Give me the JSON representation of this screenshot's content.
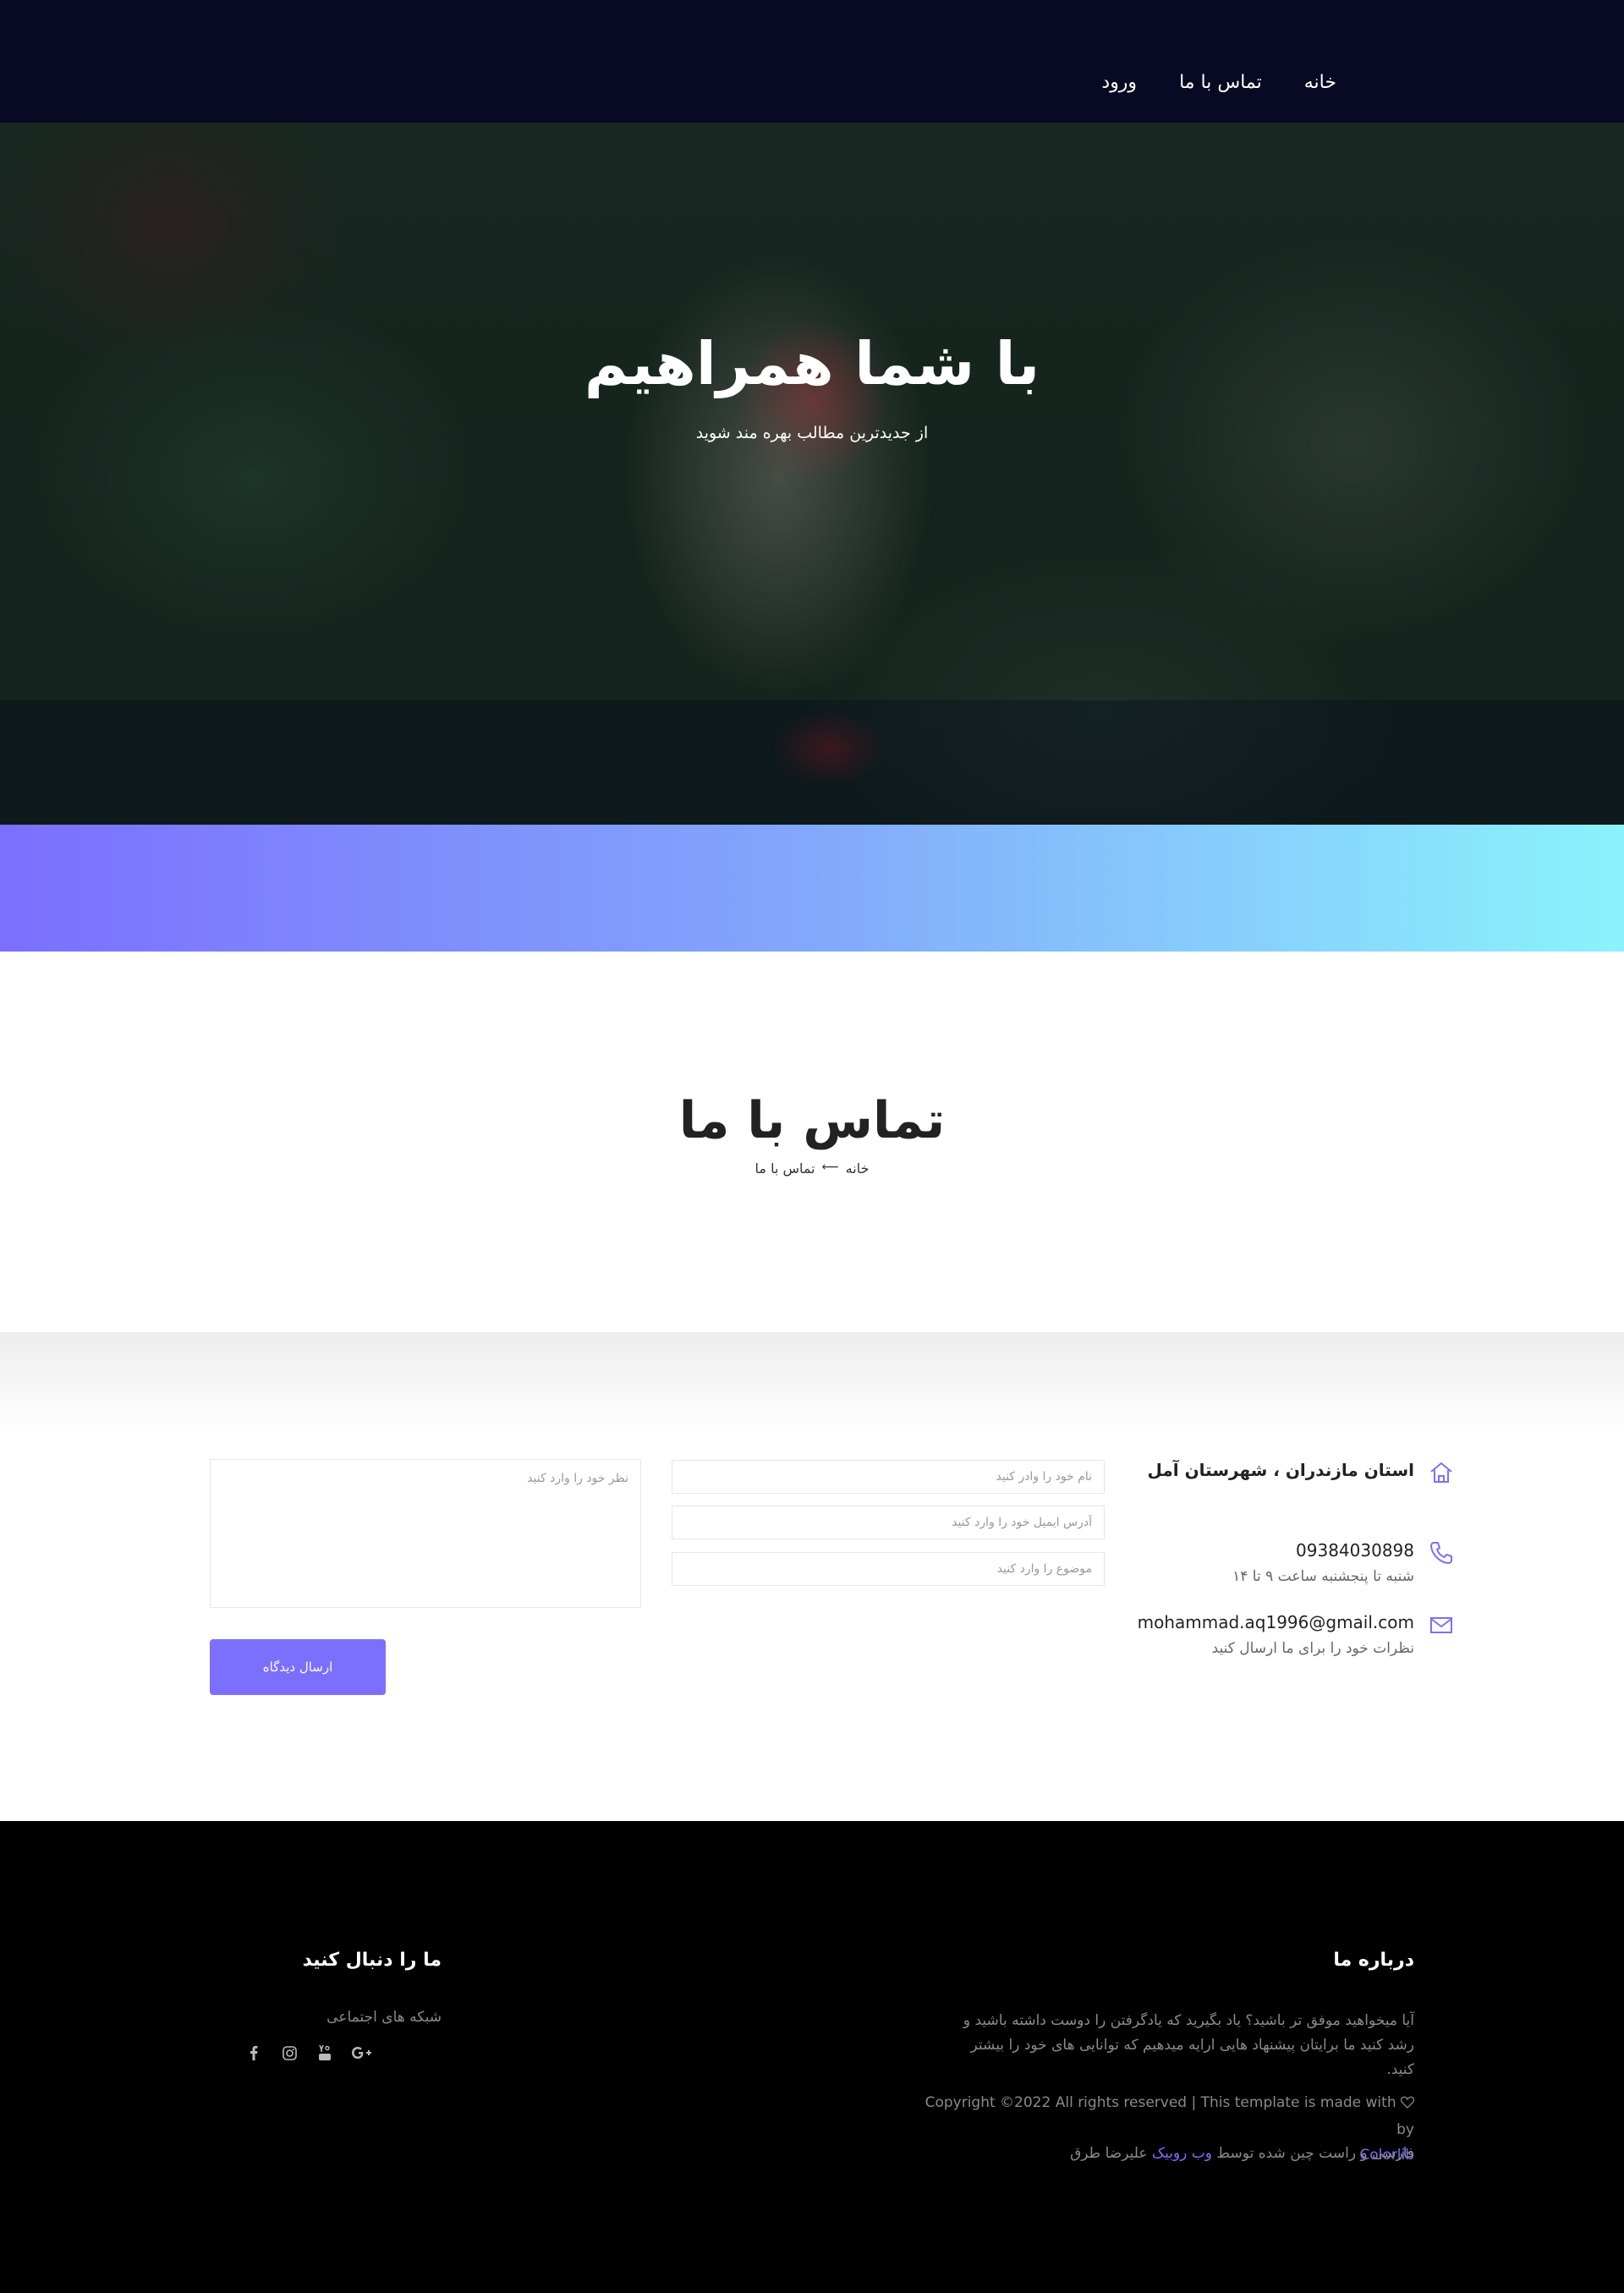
{
  "nav": {
    "items": [
      "خانه",
      "تماس با ما",
      "ورود"
    ]
  },
  "hero": {
    "title": "با شما همراهیم",
    "subtitle": "از جدیدترین مطالب بهره مند شوید"
  },
  "page": {
    "title": "تماس با ما",
    "breadcrumb": {
      "home": "خانه",
      "current": "تماس با ما"
    }
  },
  "contact": {
    "address": "استان مازندران ، شهرستان آمل",
    "phone": "09384030898",
    "phone_hours": "شنبه تا پنجشنبه ساعت ۹ تا ۱۴",
    "email": "mohammad.aq1996@gmail.com",
    "email_note": "نظرات خود را برای ما ارسال کنید"
  },
  "form": {
    "name_placeholder": "نام خود را وادر کنید",
    "email_placeholder": "آدرس ایمیل خود را وارد کنید",
    "subject_placeholder": "موضوع را وارد کنید",
    "message_placeholder": "نظر خود را وارد کنید",
    "submit_label": "ارسال دیدگاه"
  },
  "footer": {
    "about_title": "درباره ما",
    "about_text": "آیا میخواهید موفق تر باشید؟ یاد بگیرید که یادگرفتن را دوست داشته باشید و رشد کنید ما برایتان پیشنهاد هایی ارایه میدهیم که توانایی های خود را بیشتر کنید.",
    "copyright_prefix": "Copyright ©2022 All rights reserved | This template is made with",
    "copyright_by": "by",
    "copyright_link": "Colorlib",
    "fa_prefix": "فارسی و راست چین شده توسط",
    "fa_link": "وب روبیک",
    "fa_suffix": "علیرضا طرق",
    "follow_title": "ما را دنبال کنید",
    "social_label": "شبکه های اجتماعی"
  },
  "colors": {
    "nav_bg": "#070a22",
    "accent": "#7c6ffe",
    "gradient_start": "#7b6ffe",
    "gradient_end": "#8bf3fc",
    "footer_bg": "#000000"
  },
  "icons": {
    "address": "home-icon",
    "phone": "phone-icon",
    "email": "envelope-icon",
    "heart": "heart-icon",
    "social": [
      "google-plus-icon",
      "youtube-icon",
      "instagram-icon",
      "facebook-icon"
    ]
  }
}
